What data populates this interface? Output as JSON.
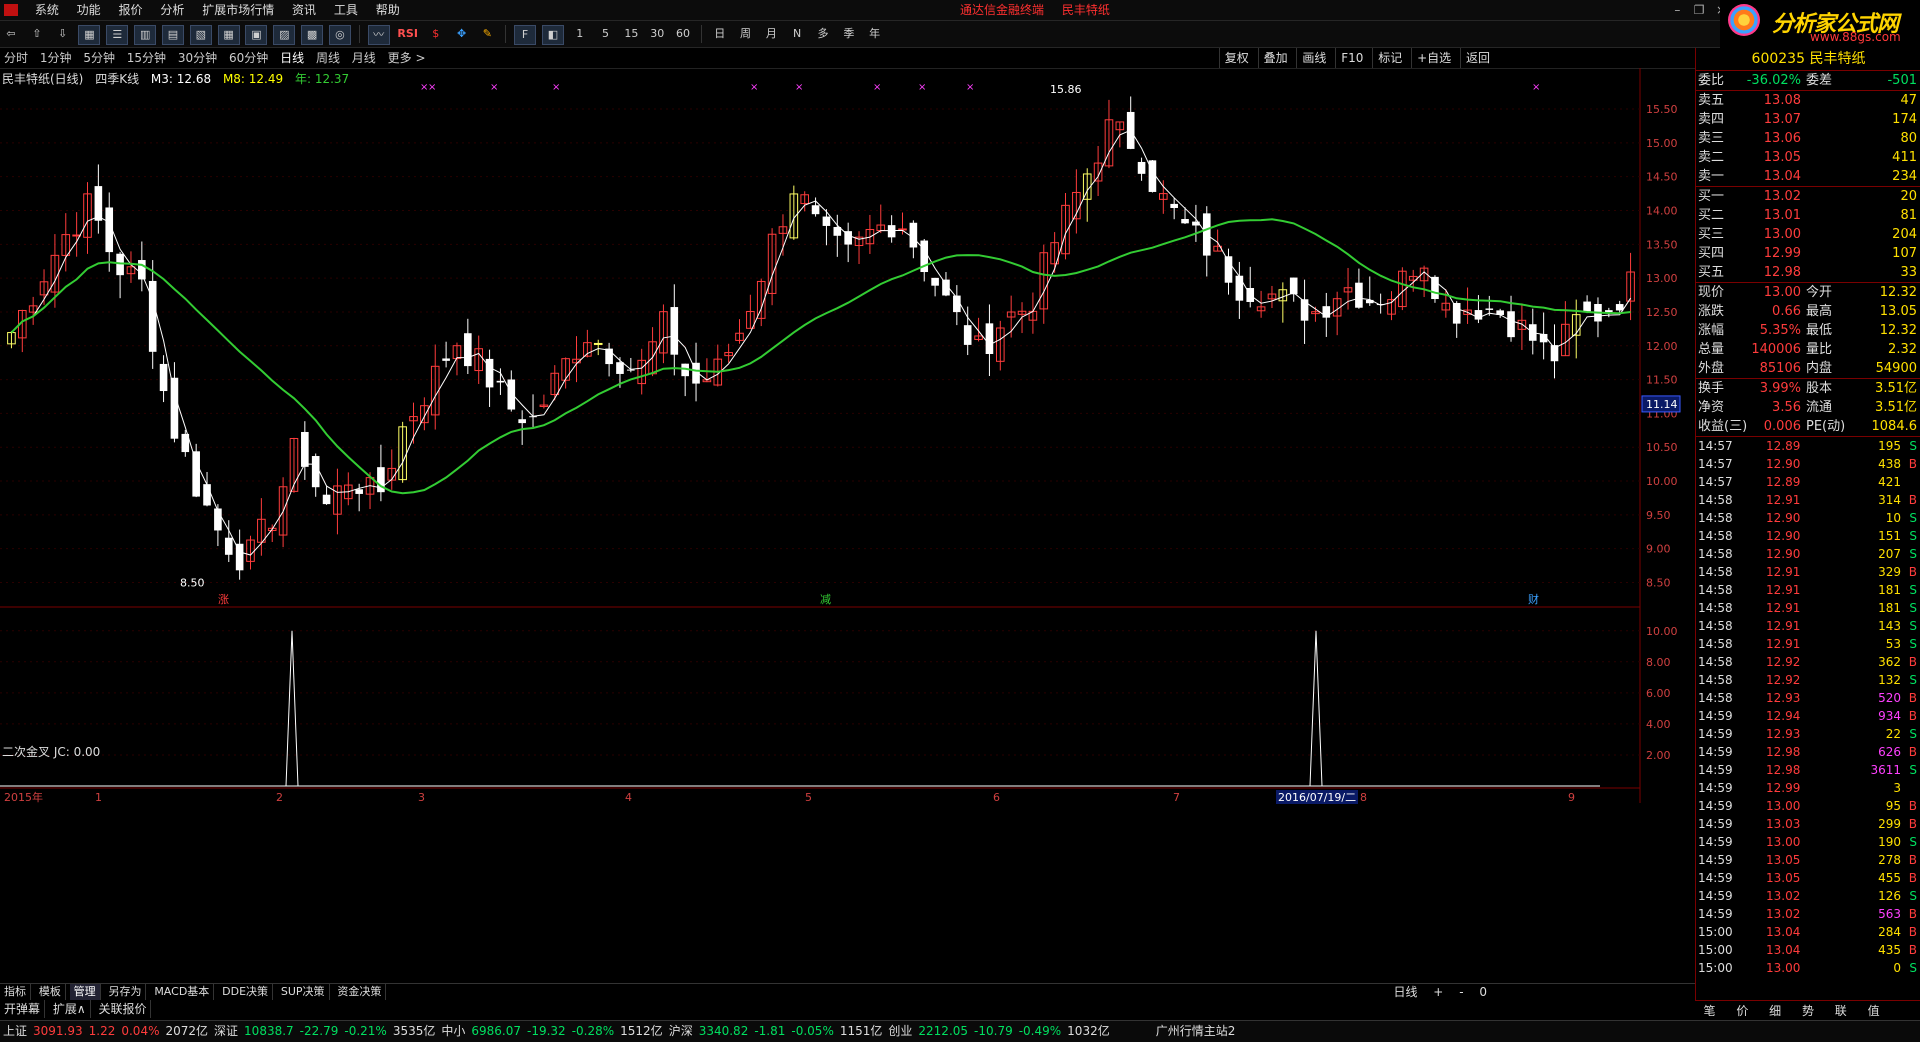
{
  "menu": {
    "items": [
      "系统",
      "功能",
      "报价",
      "分析",
      "扩展市场行情",
      "资讯",
      "工具",
      "帮助"
    ],
    "center_text": "通达信金融终端",
    "stock_title": "民丰特纸"
  },
  "logo": {
    "text": "分析家公式网",
    "url_text": "www.88gs.com"
  },
  "toolbar": {
    "period_buttons": [
      "1",
      "5",
      "15",
      "30",
      "60"
    ],
    "cycle_buttons": [
      "日",
      "周",
      "月",
      "N",
      "多",
      "季",
      "年"
    ],
    "rsi_label": "RSI"
  },
  "periods": {
    "items": [
      "分时",
      "1分钟",
      "5分钟",
      "15分钟",
      "30分钟",
      "60分钟",
      "日线",
      "周线",
      "月线",
      "更多 >"
    ],
    "active": "日线",
    "right_buttons": [
      "复权",
      "叠加",
      "画线",
      "F10",
      "标记",
      "+自选",
      "返回"
    ]
  },
  "chart_legend": {
    "name": "民丰特纸(日线)",
    "type": "四季K线",
    "ma1_label": "M3: 12.68",
    "ma2_label": "M8: 12.49",
    "year_label": "年: 12.37",
    "cursor_price": "11.14"
  },
  "indicator": {
    "legend": "二次金叉  JC: 0.00"
  },
  "chart_data": [
    {
      "type": "candlestick",
      "title": "民丰特纸(日线)",
      "ylim": [
        8.3,
        15.9
      ],
      "y_ticks": [
        "15.50",
        "15.00",
        "14.50",
        "14.00",
        "13.50",
        "13.00",
        "12.50",
        "12.00",
        "11.50",
        "11.00",
        "10.50",
        "10.00",
        "9.50",
        "9.00",
        "8.50"
      ],
      "x_labels": [
        "2015年",
        "1",
        "2",
        "3",
        "4",
        "5",
        "6",
        "7",
        "2016/07/19/二",
        "8",
        "9"
      ],
      "annotations": {
        "high": "15.86",
        "low": "8.50",
        "markers": [
          "涨",
          "减",
          "财"
        ]
      },
      "close_series_approx": [
        12.2,
        12.9,
        13.6,
        14.1,
        13.2,
        12.9,
        11.0,
        10.0,
        9.2,
        8.8,
        9.5,
        10.6,
        9.6,
        10.1,
        9.7,
        10.8,
        11.4,
        12.1,
        11.7,
        11.1,
        10.9,
        11.6,
        12.2,
        11.9,
        11.6,
        12.3,
        11.4,
        11.6,
        12.3,
        13.4,
        14.4,
        13.6,
        13.3,
        13.7,
        13.9,
        13.2,
        12.5,
        11.9,
        12.4,
        12.6,
        13.6,
        14.4,
        15.2,
        15.0,
        14.2,
        13.7,
        13.4,
        12.9,
        12.8,
        12.6,
        12.5,
        12.9,
        12.7,
        12.8,
        13.4,
        12.5,
        12.6,
        12.5,
        12.2,
        11.8,
        12.4,
        12.5,
        12.9
      ],
      "series": [
        {
          "name": "M3",
          "color": "#ffffff"
        },
        {
          "name": "M8",
          "color": "#ffff00"
        },
        {
          "name": "年",
          "color": "#33cc33"
        }
      ]
    },
    {
      "type": "line",
      "title": "二次金叉",
      "ylim": [
        0,
        10.5
      ],
      "y_ticks": [
        "10.00",
        "8.00",
        "6.00",
        "4.00",
        "2.00"
      ],
      "spike_positions": [
        0.18,
        0.82
      ],
      "spike_value": 10
    }
  ],
  "tabs": {
    "items": [
      "指标",
      "模板",
      "管理",
      "另存为",
      "MACD基本",
      "DDE决策",
      "SUP决策",
      "资金决策"
    ],
    "active": "管理",
    "right": "日线",
    "zoom": [
      "+",
      "-",
      "0"
    ]
  },
  "popbar": [
    "开弹幕",
    "扩展∧",
    "关联报价"
  ],
  "quote": {
    "code_name": "600235 民丰特纸",
    "weibi": {
      "k": "委比",
      "v": "-36.02%",
      "k2": "委差",
      "v2": "-501"
    },
    "asks": [
      {
        "k": "卖五",
        "v": "13.08",
        "q": "47"
      },
      {
        "k": "卖四",
        "v": "13.07",
        "q": "174"
      },
      {
        "k": "卖三",
        "v": "13.06",
        "q": "80"
      },
      {
        "k": "卖二",
        "v": "13.05",
        "q": "411"
      },
      {
        "k": "卖一",
        "v": "13.04",
        "q": "234"
      }
    ],
    "bids": [
      {
        "k": "买一",
        "v": "13.02",
        "q": "20"
      },
      {
        "k": "买二",
        "v": "13.01",
        "q": "81"
      },
      {
        "k": "买三",
        "v": "13.00",
        "q": "204"
      },
      {
        "k": "买四",
        "v": "12.99",
        "q": "107"
      },
      {
        "k": "买五",
        "v": "12.98",
        "q": "33"
      }
    ],
    "stats": [
      {
        "k": "现价",
        "v": "13.00",
        "k2": "今开",
        "v2": "12.32"
      },
      {
        "k": "涨跌",
        "v": "0.66",
        "k2": "最高",
        "v2": "13.05"
      },
      {
        "k": "涨幅",
        "v": "5.35%",
        "k2": "最低",
        "v2": "12.32"
      },
      {
        "k": "总量",
        "v": "140006",
        "k2": "量比",
        "v2": "2.32"
      },
      {
        "k": "外盘",
        "v": "85106",
        "k2": "内盘",
        "v2": "54900"
      }
    ],
    "stats2": [
      {
        "k": "换手",
        "v": "3.99%",
        "k2": "股本",
        "v2": "3.51亿"
      },
      {
        "k": "净资",
        "v": "3.56",
        "k2": "流通",
        "v2": "3.51亿"
      },
      {
        "k": "收益(三)",
        "v": "0.006",
        "k2": "PE(动)",
        "v2": "1084.6"
      }
    ],
    "ticks": [
      {
        "t": "14:57",
        "p": "12.89",
        "q": "195",
        "d": "S"
      },
      {
        "t": "14:57",
        "p": "12.90",
        "q": "438",
        "d": "B"
      },
      {
        "t": "14:57",
        "p": "12.89",
        "q": "421",
        "d": ""
      },
      {
        "t": "14:58",
        "p": "12.91",
        "q": "314",
        "d": "B"
      },
      {
        "t": "14:58",
        "p": "12.90",
        "q": "10",
        "d": "S"
      },
      {
        "t": "14:58",
        "p": "12.90",
        "q": "151",
        "d": "S"
      },
      {
        "t": "14:58",
        "p": "12.90",
        "q": "207",
        "d": "S"
      },
      {
        "t": "14:58",
        "p": "12.91",
        "q": "329",
        "d": "B"
      },
      {
        "t": "14:58",
        "p": "12.91",
        "q": "181",
        "d": "S"
      },
      {
        "t": "14:58",
        "p": "12.91",
        "q": "181",
        "d": "S"
      },
      {
        "t": "14:58",
        "p": "12.91",
        "q": "143",
        "d": "S"
      },
      {
        "t": "14:58",
        "p": "12.91",
        "q": "53",
        "d": "S"
      },
      {
        "t": "14:58",
        "p": "12.92",
        "q": "362",
        "d": "B"
      },
      {
        "t": "14:58",
        "p": "12.92",
        "q": "132",
        "d": "S"
      },
      {
        "t": "14:58",
        "p": "12.93",
        "q": "520",
        "d": "B"
      },
      {
        "t": "14:59",
        "p": "12.94",
        "q": "934",
        "d": "B"
      },
      {
        "t": "14:59",
        "p": "12.93",
        "q": "22",
        "d": "S"
      },
      {
        "t": "14:59",
        "p": "12.98",
        "q": "626",
        "d": "B"
      },
      {
        "t": "14:59",
        "p": "12.98",
        "q": "3611",
        "d": "S"
      },
      {
        "t": "14:59",
        "p": "12.99",
        "q": "3",
        "d": ""
      },
      {
        "t": "14:59",
        "p": "13.00",
        "q": "95",
        "d": "B"
      },
      {
        "t": "14:59",
        "p": "13.03",
        "q": "299",
        "d": "B"
      },
      {
        "t": "14:59",
        "p": "13.00",
        "q": "190",
        "d": "S"
      },
      {
        "t": "14:59",
        "p": "13.05",
        "q": "278",
        "d": "B"
      },
      {
        "t": "14:59",
        "p": "13.05",
        "q": "455",
        "d": "B"
      },
      {
        "t": "14:59",
        "p": "13.02",
        "q": "126",
        "d": "S"
      },
      {
        "t": "14:59",
        "p": "13.02",
        "q": "563",
        "d": "B"
      },
      {
        "t": "15:00",
        "p": "13.04",
        "q": "284",
        "d": "B"
      },
      {
        "t": "15:00",
        "p": "13.04",
        "q": "435",
        "d": "B"
      },
      {
        "t": "15:00",
        "p": "13.00",
        "q": "0",
        "d": "S"
      }
    ],
    "bottom_tabs": [
      "笔",
      "价",
      "细",
      "势",
      "联",
      "值",
      "主"
    ]
  },
  "status": {
    "items": [
      {
        "name": "上证",
        "val": "3091.93",
        "chg": "1.22",
        "pct": "0.04%",
        "amt": "2072亿",
        "color": "red"
      },
      {
        "name": "深证",
        "val": "10838.7",
        "chg": "-22.79",
        "pct": "-0.21%",
        "amt": "3535亿",
        "color": "green"
      },
      {
        "name": "中小",
        "val": "6986.07",
        "chg": "-19.32",
        "pct": "-0.28%",
        "amt": "1512亿",
        "color": "green"
      },
      {
        "name": "沪深",
        "val": "3340.82",
        "chg": "-1.81",
        "pct": "-0.05%",
        "amt": "1151亿",
        "color": "green"
      },
      {
        "name": "创业",
        "val": "2212.05",
        "chg": "-10.79",
        "pct": "-0.49%",
        "amt": "1032亿",
        "color": "green"
      }
    ],
    "server": "广州行情主站2"
  },
  "colors": {
    "up": "#ff3c3c",
    "down": "#ffffff",
    "ma_year": "#33cc33",
    "ma_fast": "#ffffff",
    "highlight": "#ffff00",
    "panel_border": "#7a0000"
  }
}
